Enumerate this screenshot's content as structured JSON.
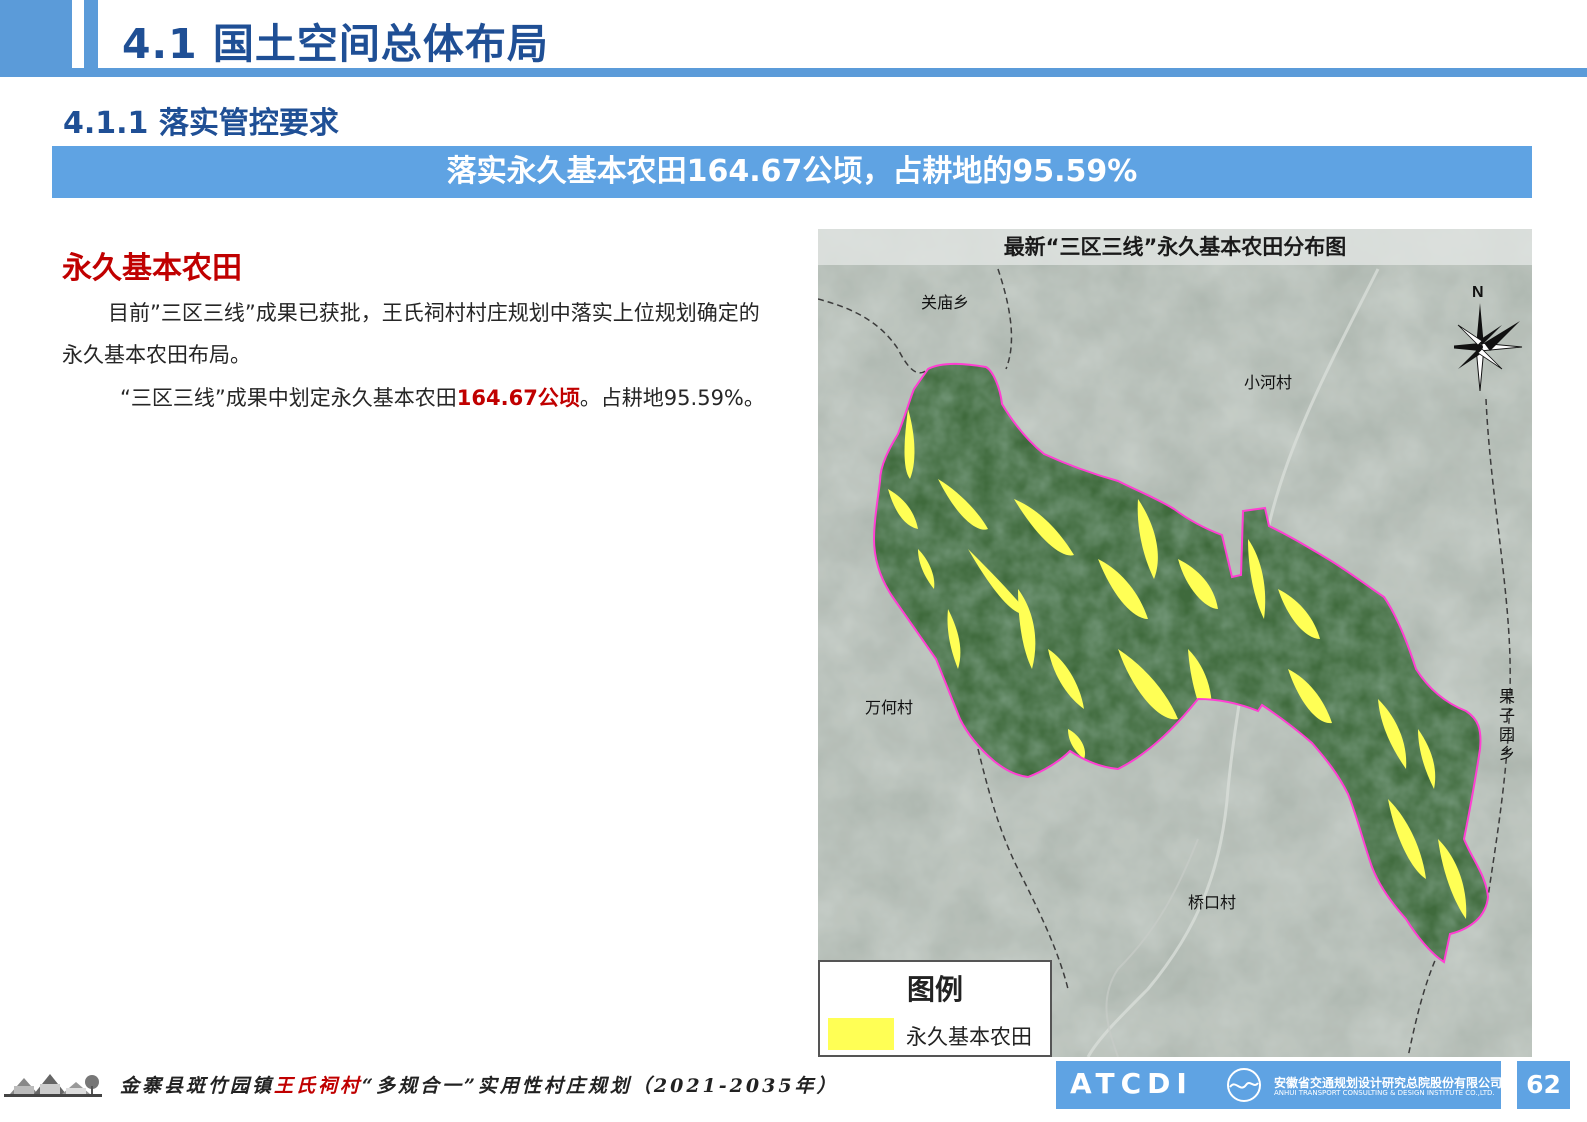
{
  "header": {
    "title": "4.1 国土空间总体布局",
    "subtitle": "4.1.1 落实管控要求"
  },
  "banner": "落实永久基本农田164.67公顷，占耕地的95.59%",
  "section": {
    "heading": "永久基本农田",
    "para1": "目前”三区三线”成果已获批，王氏祠村村庄规划中落实上位规划确定的永久基本农田布局。",
    "para2_before": "“三区三线”成果中划定永久基本农田",
    "para2_highlight": "164.67公顷",
    "para2_after": "。占耕地95.59%。"
  },
  "map": {
    "title": "最新“三区三线”永久基本农田分布图",
    "north_label": "N",
    "places": {
      "guanmiao": "关庙乡",
      "xiaohe": "小河村",
      "wanhe": "万何村",
      "guoziyuan": "果子园乡",
      "qiaokou": "桥口村"
    },
    "legend": {
      "title": "图例",
      "item_label": "永久基本农田",
      "item_color": "#ffff55"
    }
  },
  "footer": {
    "project_part1": "金寨县斑竹园镇",
    "project_red": "王氏祠村",
    "project_part2": "“多规合一”实用性村庄规划（2021-2035年）",
    "brand_short": "ATCDI",
    "brand_cn": "安徽省交通规划设计研究总院股份有限公司",
    "brand_en": "ANHUI TRANSPORT CONSULTING & DESIGN INSTITUTE CO.,LTD.",
    "page_number": "62"
  },
  "colors": {
    "accent_blue": "#5b9bd9",
    "title_navy": "#1f4f95",
    "highlight_red": "#c00000",
    "farmland_yellow": "#ffff55",
    "boundary_magenta": "#ff3fd2"
  }
}
